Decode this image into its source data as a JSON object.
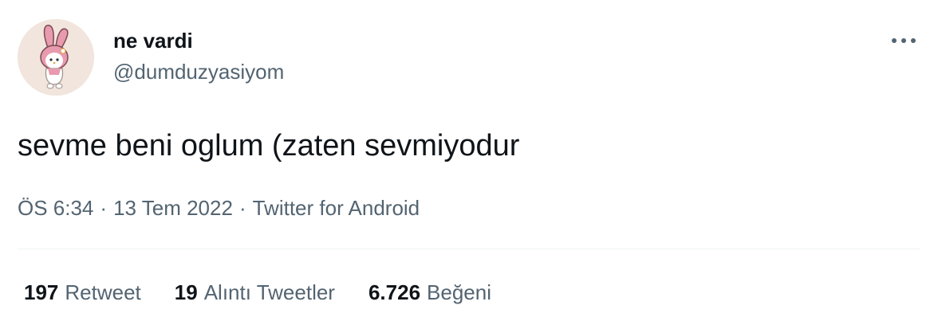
{
  "user": {
    "display_name": "ne vardi",
    "handle": "@dumduzyasiyom",
    "avatar_icon": "pink-bunny-character-avatar"
  },
  "tweet": {
    "text": "sevme beni oglum (zaten sevmiyodur",
    "time": "ÖS 6:34",
    "date": "13 Tem 2022",
    "source": "Twitter for Android",
    "separator": "·"
  },
  "stats": {
    "retweets_count": "197",
    "retweets_label": "Retweet",
    "quotes_count": "19",
    "quotes_label": "Alıntı Tweetler",
    "likes_count": "6.726",
    "likes_label": "Beğeni"
  },
  "colors": {
    "text_primary": "#0f1419",
    "text_secondary": "#536471",
    "divider": "#eff3f4"
  }
}
